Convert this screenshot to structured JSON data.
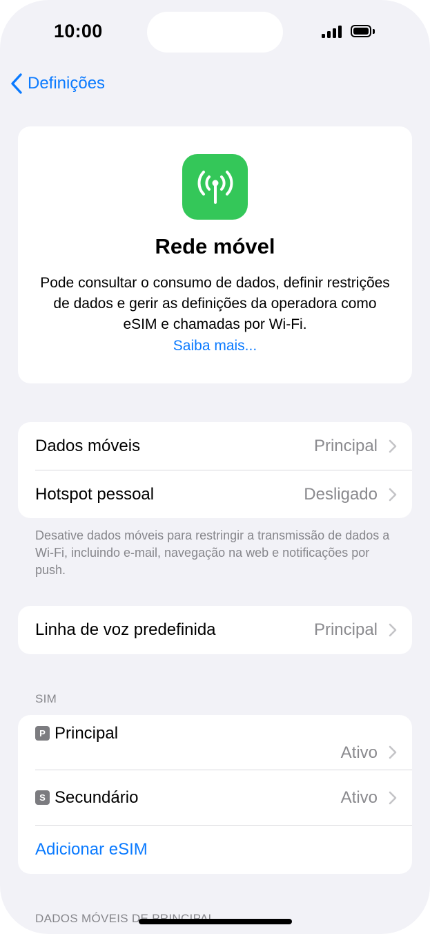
{
  "status_bar": {
    "time": "10:00"
  },
  "nav": {
    "back_label": "Definições"
  },
  "hero": {
    "title": "Rede móvel",
    "description": "Pode consultar o consumo de dados, definir restrições de dados e gerir as definições da operadora como eSIM e chamadas por Wi-Fi.",
    "link": "Saiba mais..."
  },
  "data_group": {
    "rows": [
      {
        "label": "Dados móveis",
        "value": "Principal"
      },
      {
        "label": "Hotspot pessoal",
        "value": "Desligado"
      }
    ],
    "footnote": "Desative dados móveis para restringir a transmissão de dados a Wi-Fi, incluindo e-mail, navegação na web e notificações por push."
  },
  "voice_group": {
    "rows": [
      {
        "label": "Linha de voz predefinida",
        "value": "Principal"
      }
    ]
  },
  "sim_section": {
    "header": "SIM",
    "rows": [
      {
        "badge": "P",
        "label": "Principal",
        "value": "Ativo"
      },
      {
        "badge": "S",
        "label": "Secundário",
        "value": "Ativo"
      }
    ],
    "add_label": "Adicionar eSIM"
  },
  "next_section": {
    "header": "DADOS MÓVEIS DE PRINCIPAL"
  },
  "colors": {
    "accent": "#0a7aff",
    "icon_green": "#34c759",
    "background": "#f2f2f7",
    "secondary_text": "#8a8a8e"
  },
  "icons": [
    "back-chevron-icon",
    "cellular-antenna-icon",
    "chevron-right-icon",
    "signal-icon",
    "battery-icon"
  ]
}
